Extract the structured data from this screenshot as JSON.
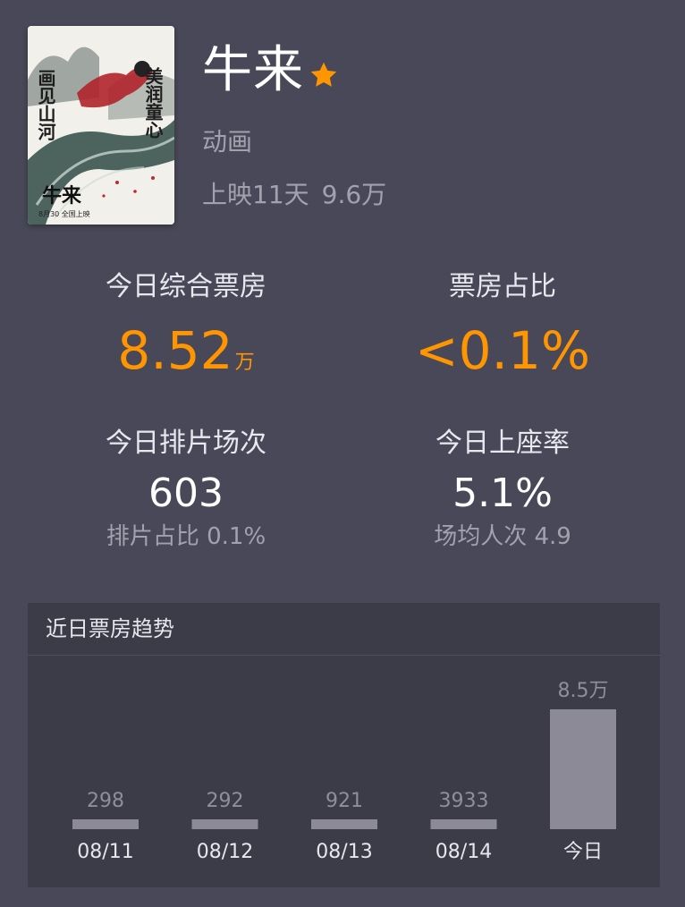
{
  "movie": {
    "title": "牛来",
    "genre": "动画",
    "days_label": "上映11天",
    "total_box": "9.6万",
    "favorite": true,
    "poster": {
      "vertical_text_left": "画见山河",
      "vertical_text_right": "美润童心",
      "bottom_title": "牛来",
      "bottom_subtitle": "8月30 全国上映"
    }
  },
  "stats": {
    "today_box": {
      "label": "今日综合票房",
      "value": "8.52",
      "unit": "万"
    },
    "box_share": {
      "label": "票房占比",
      "value": "<0.1%"
    },
    "screenings": {
      "label": "今日排片场次",
      "value": "603",
      "sub": "排片占比 0.1%"
    },
    "occupancy": {
      "label": "今日上座率",
      "value": "5.1%",
      "sub": "场均人次 4.9"
    }
  },
  "trend": {
    "title": "近日票房趋势"
  },
  "chart_data": {
    "type": "bar",
    "categories": [
      "08/11",
      "08/12",
      "08/13",
      "08/14",
      "今日"
    ],
    "values": [
      298,
      292,
      921,
      3933,
      85000
    ],
    "value_labels": [
      "298",
      "292",
      "921",
      "3933",
      "8.5万"
    ]
  },
  "colors": {
    "background": "#494858",
    "panel": "#3c3b48",
    "accent": "#ff9500",
    "bar": "#8b8a96",
    "muted_text": "#a2a1ae"
  }
}
